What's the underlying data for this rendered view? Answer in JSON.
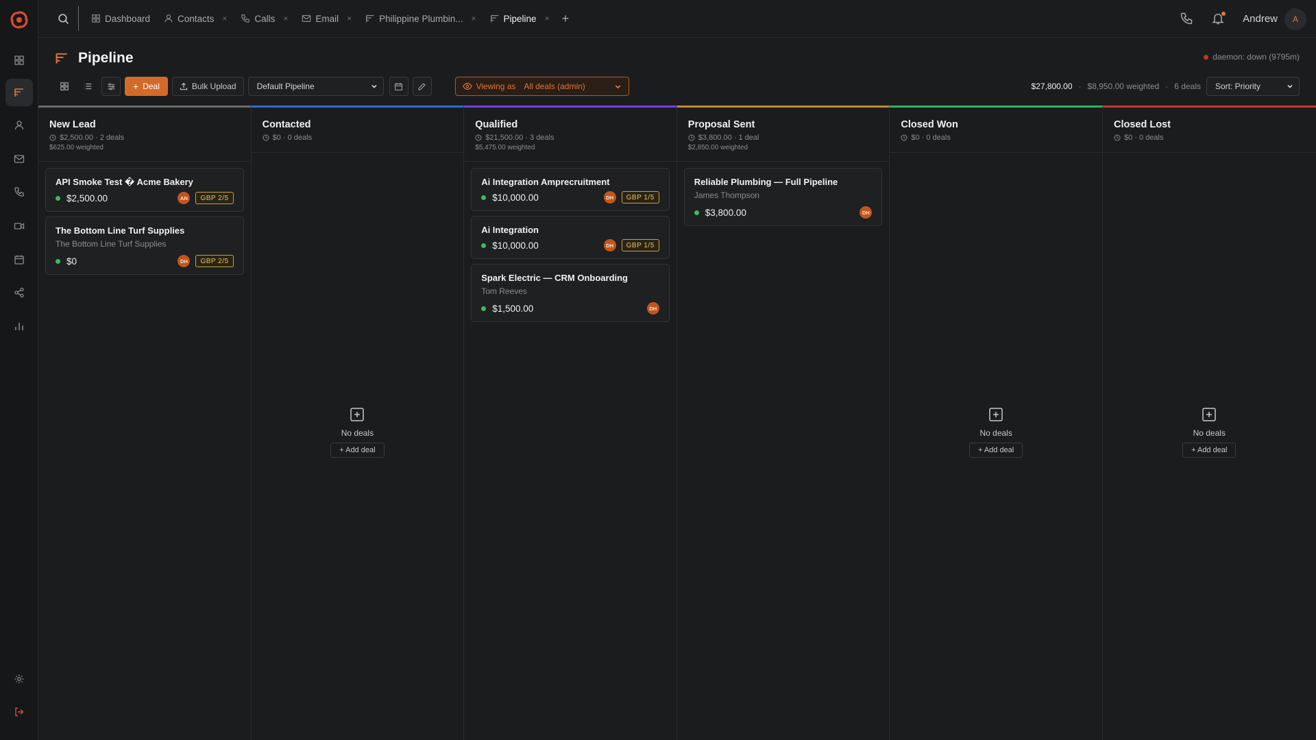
{
  "colors": {
    "accent": "#e0773a",
    "status_green": "#3fb866",
    "new_lead": "#6b6b6b",
    "contacted": "#2b6ed6",
    "qualified": "#7b3fe4",
    "proposal_sent": "#c9882a",
    "closed_won": "#2fb35c",
    "closed_lost": "#d0342c"
  },
  "rail": {
    "items": [
      {
        "icon": "grid-icon"
      },
      {
        "icon": "pipeline-icon",
        "active": true
      },
      {
        "icon": "contacts-icon"
      },
      {
        "icon": "mail-icon"
      },
      {
        "icon": "phone-icon"
      },
      {
        "icon": "video-icon"
      },
      {
        "icon": "calendar-icon"
      },
      {
        "icon": "share-icon"
      },
      {
        "icon": "analytics-icon"
      }
    ],
    "bottom": [
      {
        "icon": "gear-icon"
      },
      {
        "icon": "logout-icon"
      }
    ]
  },
  "topbar": {
    "tabs": [
      {
        "label": "Dashboard",
        "closable": false
      },
      {
        "label": "Contacts",
        "closable": true
      },
      {
        "label": "Calls",
        "closable": true
      },
      {
        "label": "Email",
        "closable": true
      },
      {
        "label": "Philippine Plumbin...",
        "closable": true
      },
      {
        "label": "Pipeline",
        "closable": true,
        "active": true
      }
    ],
    "add_tab": "+",
    "close_glyph": "×",
    "user_name": "Andrew",
    "user_initial": "A"
  },
  "header": {
    "title": "Pipeline",
    "daemon_status": "daemon: down (9795m)"
  },
  "toolbar": {
    "deal_label": "Deal",
    "bulk_upload_label": "Bulk Upload",
    "pipeline_select": "Default Pipeline",
    "viewing_as_label": "Viewing as",
    "viewing_as_value": "All deals (admin)"
  },
  "summary": {
    "total": "$27,800.00",
    "weighted": "$8,950.00 weighted",
    "deal_count": "6 deals",
    "sort": "Sort: Priority",
    "separator": "·"
  },
  "columns": [
    {
      "name": "New Lead",
      "meta": "$2,500.00 · 2 deals",
      "weighted": "$625.00 weighted",
      "cards": [
        {
          "title": "API Smoke Test � Acme Bakery",
          "subtitle": "",
          "amount": "$2,500.00",
          "avatar": "AN",
          "badge": "GBP 2/5"
        },
        {
          "title": "The Bottom Line Turf Supplies",
          "subtitle": "The Bottom Line Turf Supplies",
          "amount": "$0",
          "avatar": "DH",
          "badge": "GBP 2/5"
        }
      ]
    },
    {
      "name": "Contacted",
      "meta": "$0 · 0 deals",
      "weighted": "",
      "cards": [],
      "empty_text": "No deals",
      "add_label": "+ Add deal"
    },
    {
      "name": "Qualified",
      "meta": "$21,500.00 · 3 deals",
      "weighted": "$5,475.00 weighted",
      "cards": [
        {
          "title": "Ai Integration Amprecruitment",
          "subtitle": "",
          "amount": "$10,000.00",
          "avatar": "DH",
          "badge": "GBP 1/5"
        },
        {
          "title": "Ai Integration",
          "subtitle": "",
          "amount": "$10,000.00",
          "avatar": "DH",
          "badge": "GBP 1/5"
        },
        {
          "title": "Spark Electric — CRM Onboarding",
          "subtitle": "Tom Reeves",
          "amount": "$1,500.00",
          "avatar": "DH",
          "badge": ""
        }
      ]
    },
    {
      "name": "Proposal Sent",
      "meta": "$3,800.00 · 1 deal",
      "weighted": "$2,850.00 weighted",
      "cards": [
        {
          "title": "Reliable Plumbing — Full Pipeline",
          "subtitle": "James Thompson",
          "amount": "$3,800.00",
          "avatar": "DH",
          "badge": ""
        }
      ]
    },
    {
      "name": "Closed Won",
      "meta": "$0 · 0 deals",
      "weighted": "",
      "cards": [],
      "empty_text": "No deals",
      "add_label": "+ Add deal"
    },
    {
      "name": "Closed Lost",
      "meta": "$0 · 0 deals",
      "weighted": "",
      "cards": [],
      "empty_text": "No deals",
      "add_label": "+ Add deal"
    }
  ]
}
